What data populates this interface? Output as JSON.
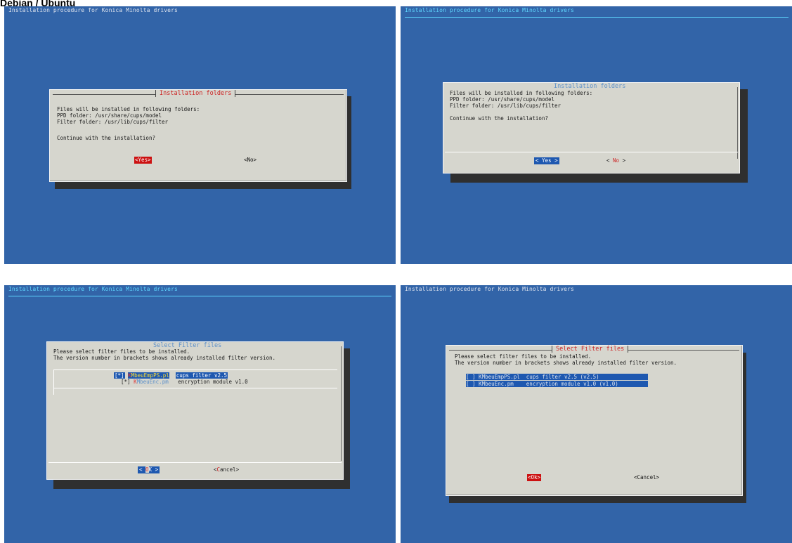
{
  "page": {
    "header": "Debian / Ubuntu"
  },
  "screens": [
    {
      "title": "Installation procedure for Konica Minolta drivers",
      "dialog_title": "Installation folders",
      "lines": [
        "Files will be installed in following folders:",
        "PPD folder: /usr/share/cups/model",
        "Filter folder: /usr/lib/cups/filter",
        "Continue with the installation?"
      ],
      "yes_label": "<Yes>",
      "no_label": "<No>"
    },
    {
      "title": "Installation procedure for Konica Minolta drivers",
      "dialog_title": "Installation folders",
      "lines": [
        "Files will be installed in following folders:",
        "PPD folder: /usr/share/cups/model",
        "Filter folder: /usr/lib/cups/filter",
        "Continue with the installation?"
      ],
      "yes_label": "< Yes >",
      "no_prefix": "< ",
      "no_hot": "No",
      "no_suffix": "  >"
    },
    {
      "title": "Installation procedure for Konica Minolta drivers",
      "dialog_title": "Select Filter files",
      "lines": [
        "Please select filter files to be installed.",
        "The version number in brackets shows already installed filter version."
      ],
      "items": [
        {
          "check": "[*]",
          "file_first": "K",
          "file_rest": "MbeuEmpPS.pl",
          "desc": "cups filter v2.5"
        },
        {
          "check": "[*]",
          "file_first": "K",
          "file_rest": "MbeuEnc.pm",
          "desc": "encryption module v1.0"
        }
      ],
      "ok_prefix": "< ",
      "ok_hot": "O",
      "ok_suffix": "K  >",
      "cancel_prefix": "<",
      "cancel_hot": "C",
      "cancel_suffix": "ancel>"
    },
    {
      "title": "Installation procedure for Konica Minolta drivers",
      "dialog_title": "Select Filter files",
      "lines": [
        "Please select filter files to be installed.",
        "The version number in brackets shows already installed filter version."
      ],
      "items": [
        {
          "text": "[ ] KMbeuEmpPS.pl  cups filter v2.5 (v2.5)"
        },
        {
          "text": "[ ] KMbeuEnc.pm    encryption module v1.0 (v1.0)"
        }
      ],
      "ok_label": "<Ok>",
      "cancel_label": "<Cancel>"
    }
  ],
  "colors": {
    "background": "#3264a8",
    "dialog": "#d6d6ce",
    "highlight_red": "#cc1111",
    "highlight_blue": "#1e58b0",
    "shadow": "#2f2f2f"
  }
}
